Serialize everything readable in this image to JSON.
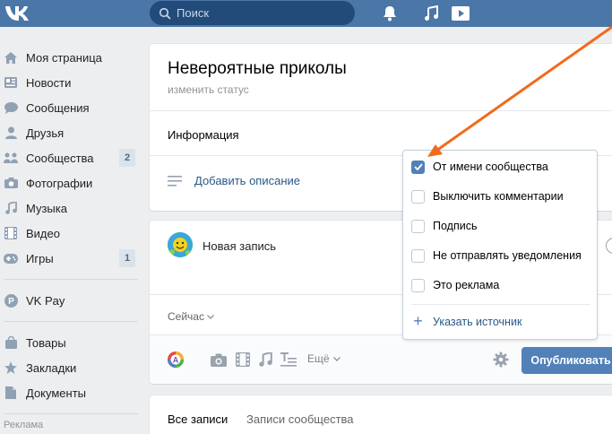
{
  "topbar": {
    "logo_text": "VK",
    "search_placeholder": "Поиск",
    "icons": [
      "bell-icon",
      "music-icon",
      "play-icon"
    ]
  },
  "sidebar": {
    "items": [
      {
        "label": "Моя страница",
        "icon": "home-icon"
      },
      {
        "label": "Новости",
        "icon": "news-icon"
      },
      {
        "label": "Сообщения",
        "icon": "message-icon"
      },
      {
        "label": "Друзья",
        "icon": "friend-icon"
      },
      {
        "label": "Сообщества",
        "icon": "groups-icon",
        "badge": "2"
      },
      {
        "label": "Фотографии",
        "icon": "camera-icon"
      },
      {
        "label": "Музыка",
        "icon": "music-icon"
      },
      {
        "label": "Видео",
        "icon": "film-icon"
      },
      {
        "label": "Игры",
        "icon": "gamepad-icon",
        "badge": "1"
      }
    ],
    "vkpay": "VK Pay",
    "items2": [
      {
        "label": "Товары",
        "icon": "bag-icon"
      },
      {
        "label": "Закладки",
        "icon": "star-icon"
      },
      {
        "label": "Документы",
        "icon": "doc-icon"
      }
    ],
    "ads": "Реклама"
  },
  "group": {
    "title": "Невероятные приколы",
    "status": "изменить статус",
    "info_label": "Информация",
    "add_description": "Добавить описание"
  },
  "post": {
    "new_post": "Новая запись",
    "time": "Сейчас",
    "more": "Ещё",
    "publish": "Опубликовать"
  },
  "tabs": [
    "Все записи",
    "Записи сообщества"
  ],
  "dropdown": {
    "items": [
      {
        "label": "От имени сообщества",
        "checked": true
      },
      {
        "label": "Выключить комментарии",
        "checked": false
      },
      {
        "label": "Подпись",
        "checked": false
      },
      {
        "label": "Не отправлять уведомления",
        "checked": false
      },
      {
        "label": "Это реклама",
        "checked": false
      }
    ],
    "source": "Указать источник"
  },
  "colors": {
    "header": "#4a76a8",
    "accent": "#5181b8",
    "link": "#2a5885",
    "arrow": "#f26a1b"
  }
}
